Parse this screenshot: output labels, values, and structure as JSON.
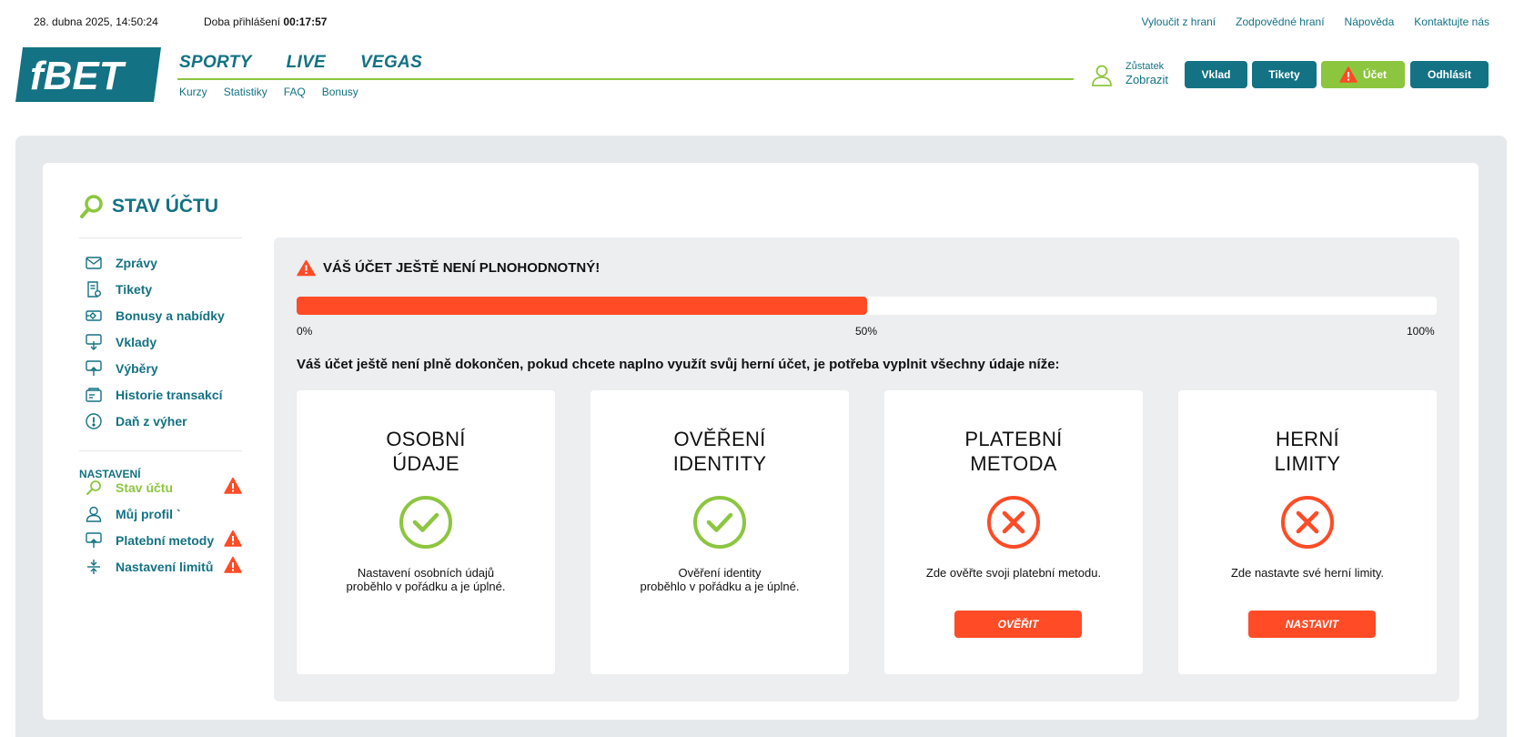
{
  "topbar": {
    "datetime": "28. dubna 2025, 14:50:24",
    "session_label": "Doba přihlášení",
    "session_time": "00:17:57",
    "links": [
      "Vyloučit z hraní",
      "Zodpovědné hraní",
      "Nápověda",
      "Kontaktujte nás"
    ]
  },
  "header": {
    "logo_text": "fBET",
    "nav_main": [
      "SPORTY",
      "LIVE",
      "VEGAS"
    ],
    "nav_sub": [
      "Kurzy",
      "Statistiky",
      "FAQ",
      "Bonusy"
    ],
    "balance_label": "Zůstatek",
    "balance_value": "Zobrazit",
    "buttons": {
      "deposit": "Vklad",
      "tickets": "Tikety",
      "account": "Účet",
      "logout": "Odhlásit"
    }
  },
  "sidebar": {
    "title": "STAV ÚČTU",
    "items": [
      {
        "label": "Zprávy",
        "icon": "mail-icon"
      },
      {
        "label": "Tikety",
        "icon": "ticket-icon"
      },
      {
        "label": "Bonusy a nabídky",
        "icon": "bonus-icon"
      },
      {
        "label": "Vklady",
        "icon": "deposit-icon"
      },
      {
        "label": "Výběry",
        "icon": "withdraw-icon"
      },
      {
        "label": "Historie transakcí",
        "icon": "history-icon"
      },
      {
        "label": "Daň z výher",
        "icon": "tax-icon"
      }
    ],
    "settings_heading": "NASTAVENÍ",
    "settings_items": [
      {
        "label": "Stav účtu",
        "icon": "search-icon",
        "warning": true,
        "active": true
      },
      {
        "label": "Můj profil `",
        "icon": "user-icon",
        "warning": false
      },
      {
        "label": "Platební metody",
        "icon": "payment-icon",
        "warning": true
      },
      {
        "label": "Nastavení limitů",
        "icon": "limits-icon",
        "warning": true
      }
    ]
  },
  "status": {
    "alert": "VÁŠ ÚČET JEŠTĚ NENÍ PLNOHODNOTNÝ!",
    "progress_percent": 50,
    "progress_labels": [
      "0%",
      "50%",
      "100%"
    ],
    "instruction": "Váš účet ještě není plně dokončen, pokud chcete naplno využít svůj herní účet, je potřeba vyplnit všechny údaje níže:"
  },
  "steps": [
    {
      "title_line1": "OSOBNÍ",
      "title_line2": "ÚDAJE",
      "state": "done",
      "desc_line1": "Nastavení osobních údajů",
      "desc_line2": "proběhlo v pořádku a je úplné.",
      "button": ""
    },
    {
      "title_line1": "OVĚŘENÍ",
      "title_line2": "IDENTITY",
      "state": "done",
      "desc_line1": "Ověření identity",
      "desc_line2": "proběhlo v pořádku a je úplné.",
      "button": ""
    },
    {
      "title_line1": "PLATEBNÍ",
      "title_line2": "METODA",
      "state": "missing",
      "desc_line1": "Zde ověřte svoji platební metodu.",
      "desc_line2": "",
      "button": "OVĚŘIT"
    },
    {
      "title_line1": "HERNÍ",
      "title_line2": "LIMITY",
      "state": "missing",
      "desc_line1": "Zde nastavte své herní limity.",
      "desc_line2": "",
      "button": "NASTAVIT"
    }
  ],
  "colors": {
    "brand": "#137283",
    "accent_green": "#8cc63f",
    "alert_red": "#ff4b26",
    "panel_bg": "#e6e9ec"
  }
}
